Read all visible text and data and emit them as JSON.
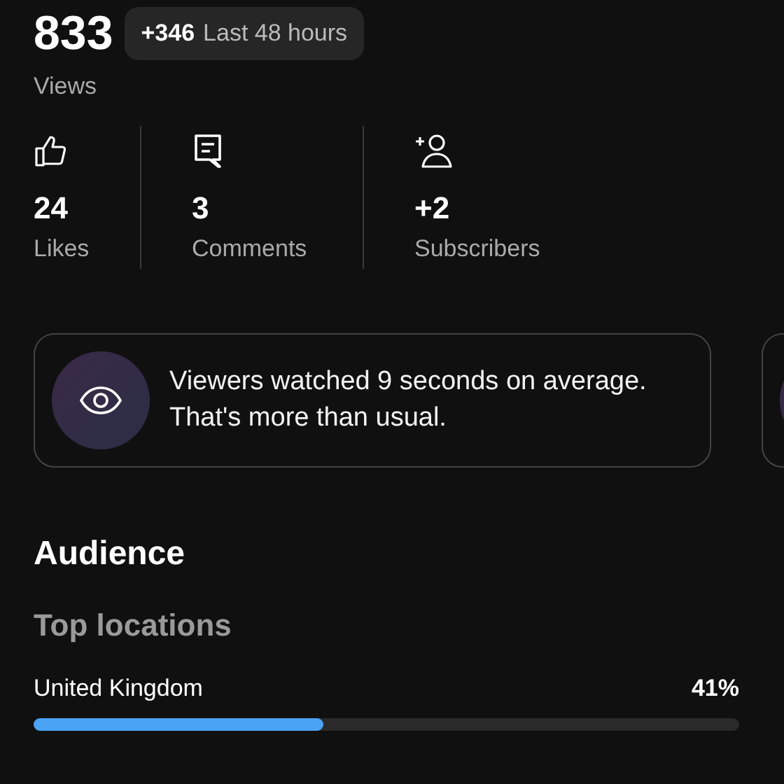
{
  "views": {
    "value": "833",
    "label": "Views",
    "badge": {
      "delta": "+346",
      "period": "Last 48 hours"
    }
  },
  "stats": [
    {
      "kind": "likes",
      "value": "24",
      "label": "Likes"
    },
    {
      "kind": "comments",
      "value": "3",
      "label": "Comments"
    },
    {
      "kind": "subscribers",
      "value": "+2",
      "label": "Subscribers"
    }
  ],
  "insight_cards": [
    {
      "kind": "watch-time",
      "text": "Viewers watched 9 seconds on average. That's more than usual."
    },
    {
      "kind": "cut-off"
    }
  ],
  "audience": {
    "title": "Audience",
    "subtitle": "Top locations",
    "locations": [
      {
        "name": "United Kingdom",
        "share": "41%",
        "level": 0.41
      }
    ]
  }
}
